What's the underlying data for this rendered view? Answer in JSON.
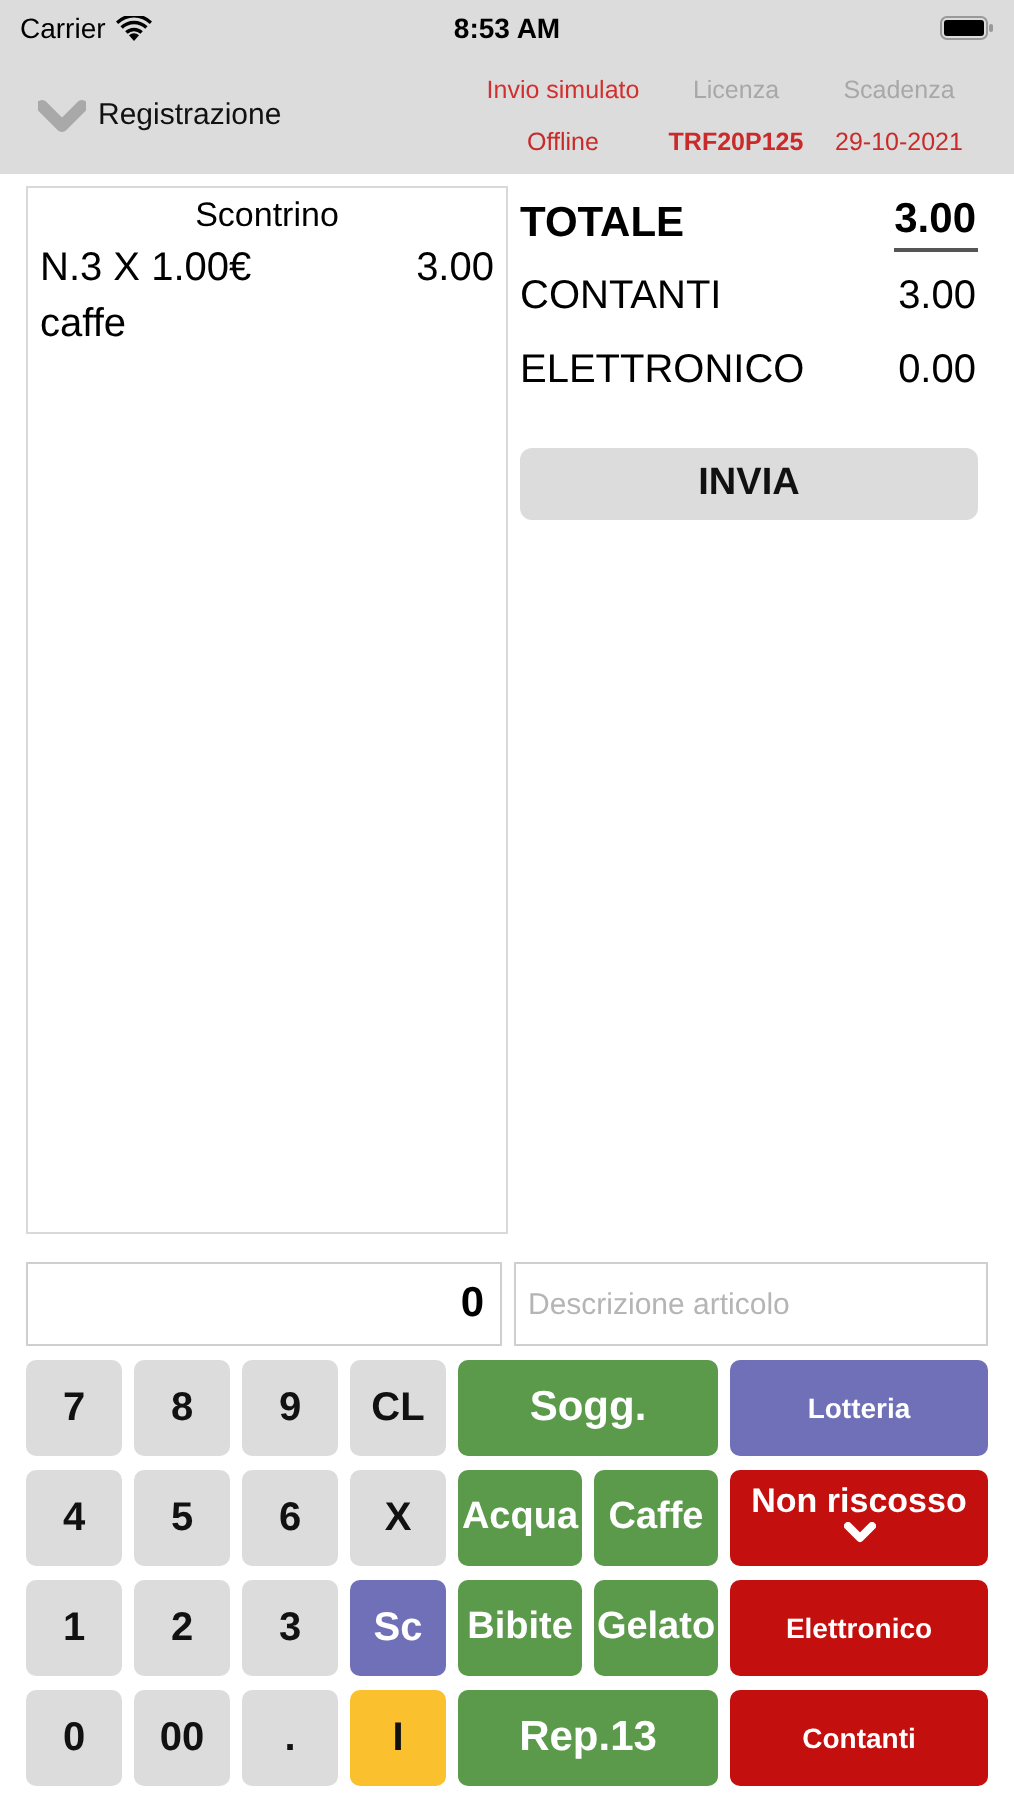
{
  "status_bar": {
    "carrier": "Carrier",
    "time": "8:53 AM"
  },
  "header": {
    "title": "Registrazione",
    "info": [
      {
        "label": "Invio simulato",
        "highlighted": true,
        "value": "Offline",
        "value_bold": false
      },
      {
        "label": "Licenza",
        "highlighted": false,
        "value": "TRF20P125",
        "value_bold": true
      },
      {
        "label": "Scadenza",
        "highlighted": false,
        "value": "29-10-2021",
        "value_bold": false
      }
    ]
  },
  "receipt": {
    "title": "Scontrino",
    "lines": [
      {
        "text": "N.3 X 1.00€",
        "amount": "3.00"
      },
      {
        "text": "caffe"
      }
    ]
  },
  "totals": [
    {
      "label": "TOTALE",
      "value": "3.00",
      "kind": "total"
    },
    {
      "label": "CONTANTI",
      "value": "3.00",
      "kind": "normal"
    },
    {
      "label": "ELETTRONICO",
      "value": "0.00",
      "kind": "normal"
    }
  ],
  "send_button": "INVIA",
  "amount_field": {
    "value": "0"
  },
  "description_field": {
    "placeholder": "Descrizione articolo"
  },
  "keys": [
    {
      "label": "7",
      "kind": "gray"
    },
    {
      "label": "8",
      "kind": "gray"
    },
    {
      "label": "9",
      "kind": "gray"
    },
    {
      "label": "CL",
      "kind": "gray"
    },
    {
      "label": "Sogg.",
      "kind": "green-wide"
    },
    {
      "label": "Lotteria",
      "kind": "purple-small"
    },
    {
      "label": "4",
      "kind": "gray"
    },
    {
      "label": "5",
      "kind": "gray"
    },
    {
      "label": "6",
      "kind": "gray"
    },
    {
      "label": "X",
      "kind": "gray"
    },
    {
      "label": "Acqua",
      "kind": "green"
    },
    {
      "label": "Caffe",
      "kind": "green"
    },
    {
      "label": "Non riscosso",
      "kind": "red-chevron"
    },
    {
      "label": "1",
      "kind": "gray"
    },
    {
      "label": "2",
      "kind": "gray"
    },
    {
      "label": "3",
      "kind": "gray"
    },
    {
      "label": "Sc",
      "kind": "purple"
    },
    {
      "label": "Bibite",
      "kind": "green"
    },
    {
      "label": "Gelato",
      "kind": "green"
    },
    {
      "label": "Elettronico",
      "kind": "red"
    },
    {
      "label": "0",
      "kind": "gray"
    },
    {
      "label": "00",
      "kind": "gray"
    },
    {
      "label": ".",
      "kind": "gray"
    },
    {
      "label": "I",
      "kind": "yellow"
    },
    {
      "label": "Rep.13",
      "kind": "green-wide"
    },
    {
      "label": "Contanti",
      "kind": "red"
    }
  ]
}
